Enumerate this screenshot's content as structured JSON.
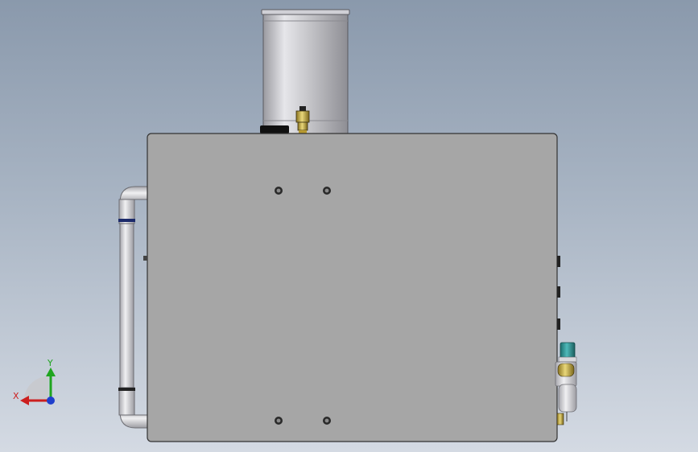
{
  "viewport": {
    "background_top": "#8a99ac",
    "background_bottom": "#d4dae3"
  },
  "model": {
    "body_color": "#a6a6a6",
    "tank_color": "#c8c8cc",
    "pipe_color": "#d8d8dc",
    "fitting_color": "#c9b24a",
    "sensor_color": "#2e8b8b"
  },
  "triad": {
    "x_label": "X",
    "y_label": "Y",
    "x_color": "#cc1f1f",
    "y_color": "#1fa51f",
    "z_color": "#1f3fcc",
    "icon": "coordinate-triad-icon"
  }
}
